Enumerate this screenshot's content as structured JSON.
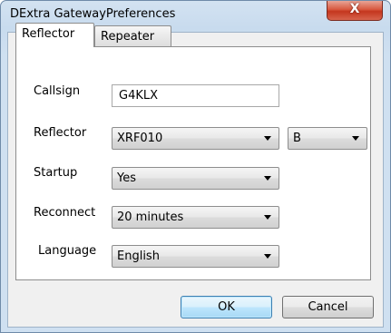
{
  "window": {
    "title": "DExtra GatewayPreferences",
    "close_glyph": "X"
  },
  "tabs": [
    {
      "label": "Reflector",
      "active": true
    },
    {
      "label": "Repeater",
      "active": false
    }
  ],
  "form": {
    "callsign_label": "Callsign",
    "callsign_value": "G4KLX",
    "reflector_label": "Reflector",
    "reflector_value": "XRF010",
    "module_value": "B",
    "startup_label": "Startup",
    "startup_value": "Yes",
    "reconnect_label": "Reconnect",
    "reconnect_value": "20 minutes",
    "language_label": "Language",
    "language_value": "English"
  },
  "buttons": {
    "ok": "OK",
    "cancel": "Cancel"
  }
}
